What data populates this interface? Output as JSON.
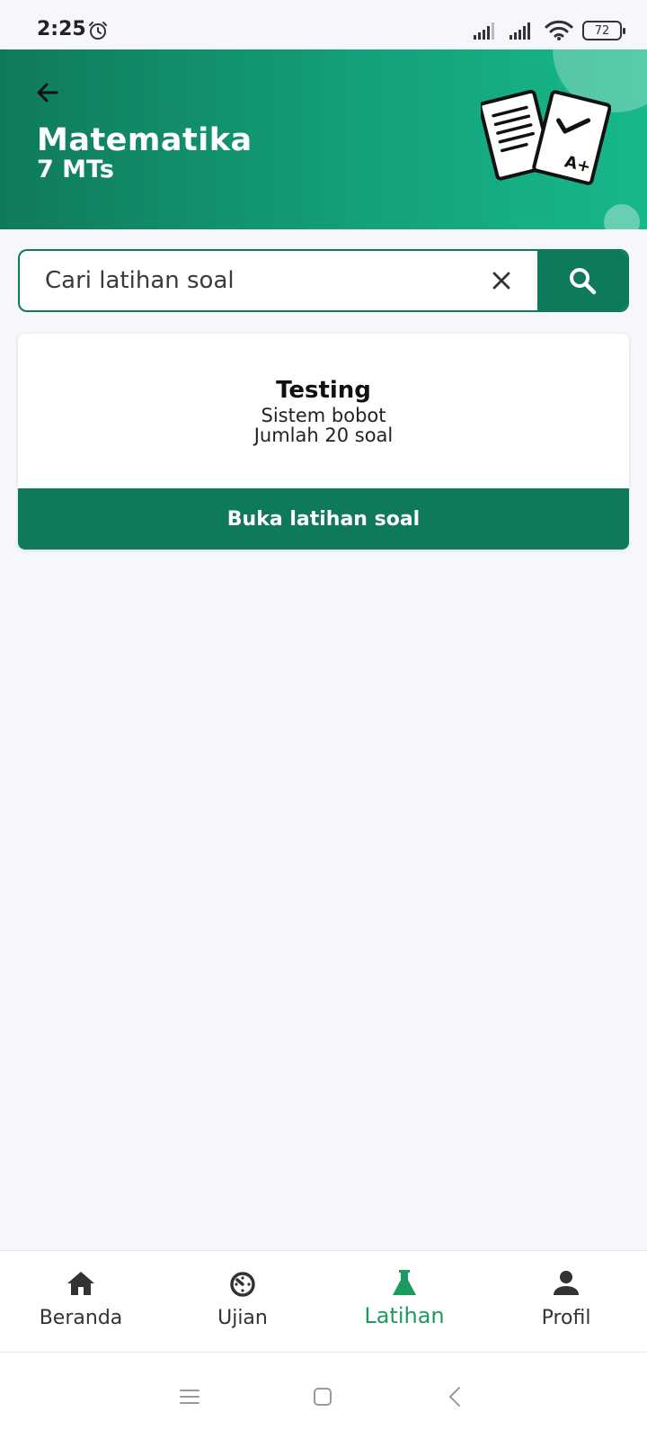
{
  "status_bar": {
    "time": "2:25",
    "battery": "72",
    "icons": [
      "alarm-icon",
      "signal-icon",
      "signal-icon",
      "wifi-icon",
      "battery-icon"
    ]
  },
  "header": {
    "title": "Matematika",
    "subtitle": "7 MTs",
    "back_icon": "arrow-left-icon",
    "illustration": "exam-papers-icon",
    "gradient_start": "#0f7a5b",
    "gradient_end": "#17b88a"
  },
  "search": {
    "placeholder": "Cari latihan soal",
    "value": "",
    "clear_icon": "close-icon",
    "search_icon": "search-icon"
  },
  "exercise_card": {
    "title": "Testing",
    "line1": "Sistem bobot",
    "line2": "Jumlah 20 soal",
    "button_label": "Buka latihan soal"
  },
  "bottom_nav": {
    "items": [
      {
        "label": "Beranda",
        "icon": "home-icon",
        "active": false
      },
      {
        "label": "Ujian",
        "icon": "timer-icon",
        "active": false
      },
      {
        "label": "Latihan",
        "icon": "flask-icon",
        "active": true
      },
      {
        "label": "Profil",
        "icon": "person-icon",
        "active": false
      }
    ],
    "active_color": "#1d9a5e"
  },
  "system_nav": {
    "icons": [
      "menu-icon",
      "home-square-icon",
      "back-chevron-icon"
    ]
  },
  "colors": {
    "primary": "#0e7a5b",
    "background": "#f5f7fb"
  }
}
